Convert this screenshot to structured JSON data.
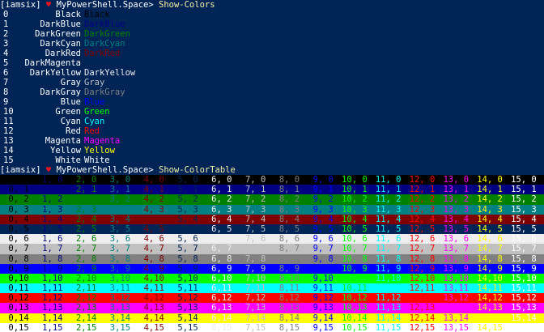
{
  "prompt1": {
    "user": "[iamsix]",
    "heart": "♥",
    "path": "MyPowerShell.Space>",
    "command": "Show-Colors"
  },
  "prompt2": {
    "user": "[iamsix]",
    "heart": "♥",
    "path": "MyPowerShell.Space>",
    "command": "Show-ColorTable"
  },
  "colors": [
    {
      "num": "0",
      "name": "Black",
      "hex": "#000000"
    },
    {
      "num": "1",
      "name": "DarkBlue",
      "hex": "#000080"
    },
    {
      "num": "2",
      "name": "DarkGreen",
      "hex": "#008000"
    },
    {
      "num": "3",
      "name": "DarkCyan",
      "hex": "#008080"
    },
    {
      "num": "4",
      "name": "DarkRed",
      "hex": "#800000"
    },
    {
      "num": "5",
      "name": "DarkMagenta",
      "hex": "#012456"
    },
    {
      "num": "6",
      "name": "DarkYellow",
      "hex": "#eeedf0"
    },
    {
      "num": "7",
      "name": "Gray",
      "hex": "#c0c0c0"
    },
    {
      "num": "8",
      "name": "DarkGray",
      "hex": "#808080"
    },
    {
      "num": "9",
      "name": "Blue",
      "hex": "#0000ff"
    },
    {
      "num": "10",
      "name": "Green",
      "hex": "#00ff00"
    },
    {
      "num": "11",
      "name": "Cyan",
      "hex": "#00ffff"
    },
    {
      "num": "12",
      "name": "Red",
      "hex": "#ff0000"
    },
    {
      "num": "13",
      "name": "Magenta",
      "hex": "#ff00ff"
    },
    {
      "num": "14",
      "name": "Yellow",
      "hex": "#ffff00"
    },
    {
      "num": "15",
      "name": "White",
      "hex": "#ffffff"
    }
  ]
}
